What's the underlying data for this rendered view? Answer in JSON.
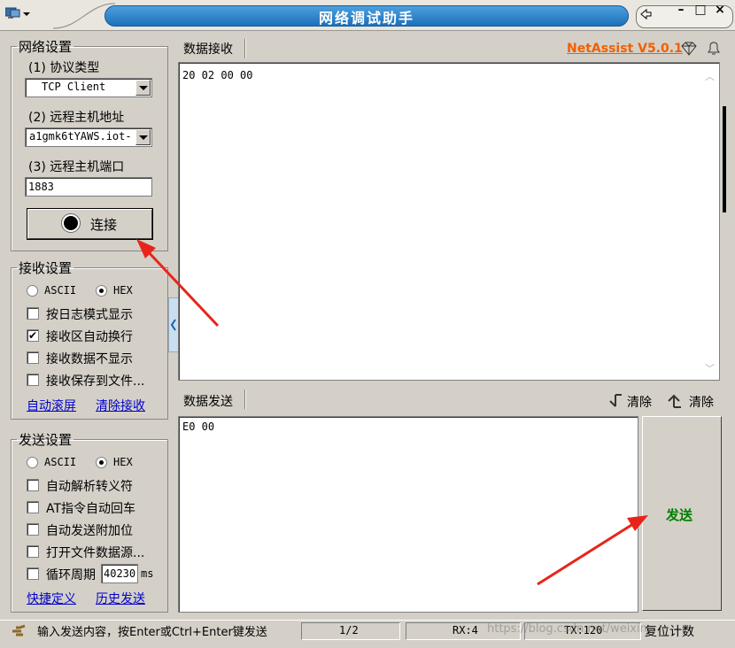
{
  "window": {
    "title": "网络调试助手",
    "brand": "NetAssist V5.0.1",
    "brand_color": "#f06000",
    "minimize": "–",
    "maximize": "□",
    "close": "×"
  },
  "network": {
    "legend": "网络设置",
    "protocol_label": "(1) 协议类型",
    "protocol_value": "TCP Client",
    "host_label": "(2) 远程主机地址",
    "host_value": "a1gmk6tYAWS.iot-",
    "port_label": "(3) 远程主机端口",
    "port_value": "1883",
    "connect_label": "连接"
  },
  "receive": {
    "legend": "接收设置",
    "ascii": "ASCII",
    "hex": "HEX",
    "hex_selected": true,
    "options": [
      {
        "label": "按日志模式显示",
        "checked": false
      },
      {
        "label": "接收区自动换行",
        "checked": true
      },
      {
        "label": "接收数据不显示",
        "checked": false
      },
      {
        "label": "接收保存到文件...",
        "checked": false
      }
    ],
    "link_auto_scroll": "自动滚屏",
    "link_clear": "清除接收"
  },
  "send_settings": {
    "legend": "发送设置",
    "ascii": "ASCII",
    "hex": "HEX",
    "hex_selected": true,
    "options": [
      {
        "label": "自动解析转义符",
        "checked": false
      },
      {
        "label": "AT指令自动回车",
        "checked": false
      },
      {
        "label": "自动发送附加位",
        "checked": false
      },
      {
        "label": "打开文件数据源...",
        "checked": false
      }
    ],
    "loop_label": "循环周期",
    "loop_value": "40230",
    "loop_unit": "ms",
    "link_shortcut": "快捷定义",
    "link_history": "历史发送"
  },
  "receive_panel": {
    "tab": "数据接收",
    "content": "20 02 00 00"
  },
  "send_panel": {
    "tab": "数据发送",
    "clear1": "清除",
    "clear2": "清除",
    "content": "E0 00",
    "send_label": "发送",
    "send_color": "#008000"
  },
  "status": {
    "hint": "输入发送内容，按Enter或Ctrl+Enter键发送",
    "page": "1/2",
    "rx": "RX:4",
    "tx": "TX:120",
    "reset": "复位计数",
    "watermark": "https://blog.csdn.net/weixin_"
  },
  "annotation_color": "#e8241a"
}
